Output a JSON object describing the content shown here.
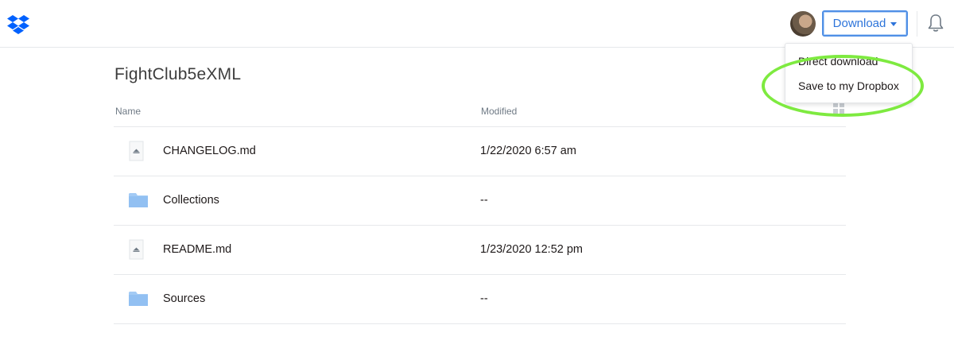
{
  "header": {
    "logo_icon": "dropbox-logo-icon",
    "avatar_icon": "user-avatar",
    "download_label": "Download",
    "bell_icon": "bell-icon"
  },
  "download_menu": {
    "items": [
      {
        "label": "Direct download"
      },
      {
        "label": "Save to my Dropbox"
      }
    ],
    "highlight_color": "#7eea40"
  },
  "folder": {
    "title": "FightClub5eXML"
  },
  "table": {
    "columns": [
      "Name",
      "Modified"
    ],
    "view_toggle_icon": "grid-view-icon",
    "rows": [
      {
        "name": "CHANGELOG.md",
        "modified": "1/22/2020 6:57 am",
        "icon": "markdown-file-icon"
      },
      {
        "name": "Collections",
        "modified": "--",
        "icon": "folder-icon"
      },
      {
        "name": "README.md",
        "modified": "1/23/2020 12:52 pm",
        "icon": "markdown-file-icon"
      },
      {
        "name": "Sources",
        "modified": "--",
        "icon": "folder-icon"
      }
    ]
  },
  "colors": {
    "accent": "#2d74da",
    "folder": "#a3cbf5",
    "divider": "#e6e8eb"
  }
}
